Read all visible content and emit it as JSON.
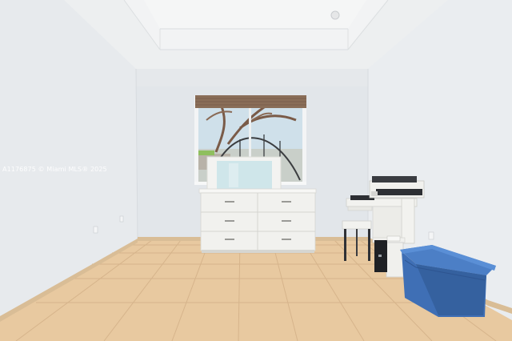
{
  "photo": {
    "watermark": "A1176875 © Miami MLS® 2025"
  },
  "colors": {
    "wall_left": "#e7eaed",
    "wall_back": "#e2e6ea",
    "wall_right": "#eaedf0",
    "ceiling": "#eef0f1",
    "floor_tile": "#e8c9a0",
    "grout": "#d6b48b",
    "baseboard": "#d9bd96",
    "dresser": "#f1f1ee",
    "bin_blue": "#3f6fb5",
    "blinds": "#8a6e58"
  }
}
